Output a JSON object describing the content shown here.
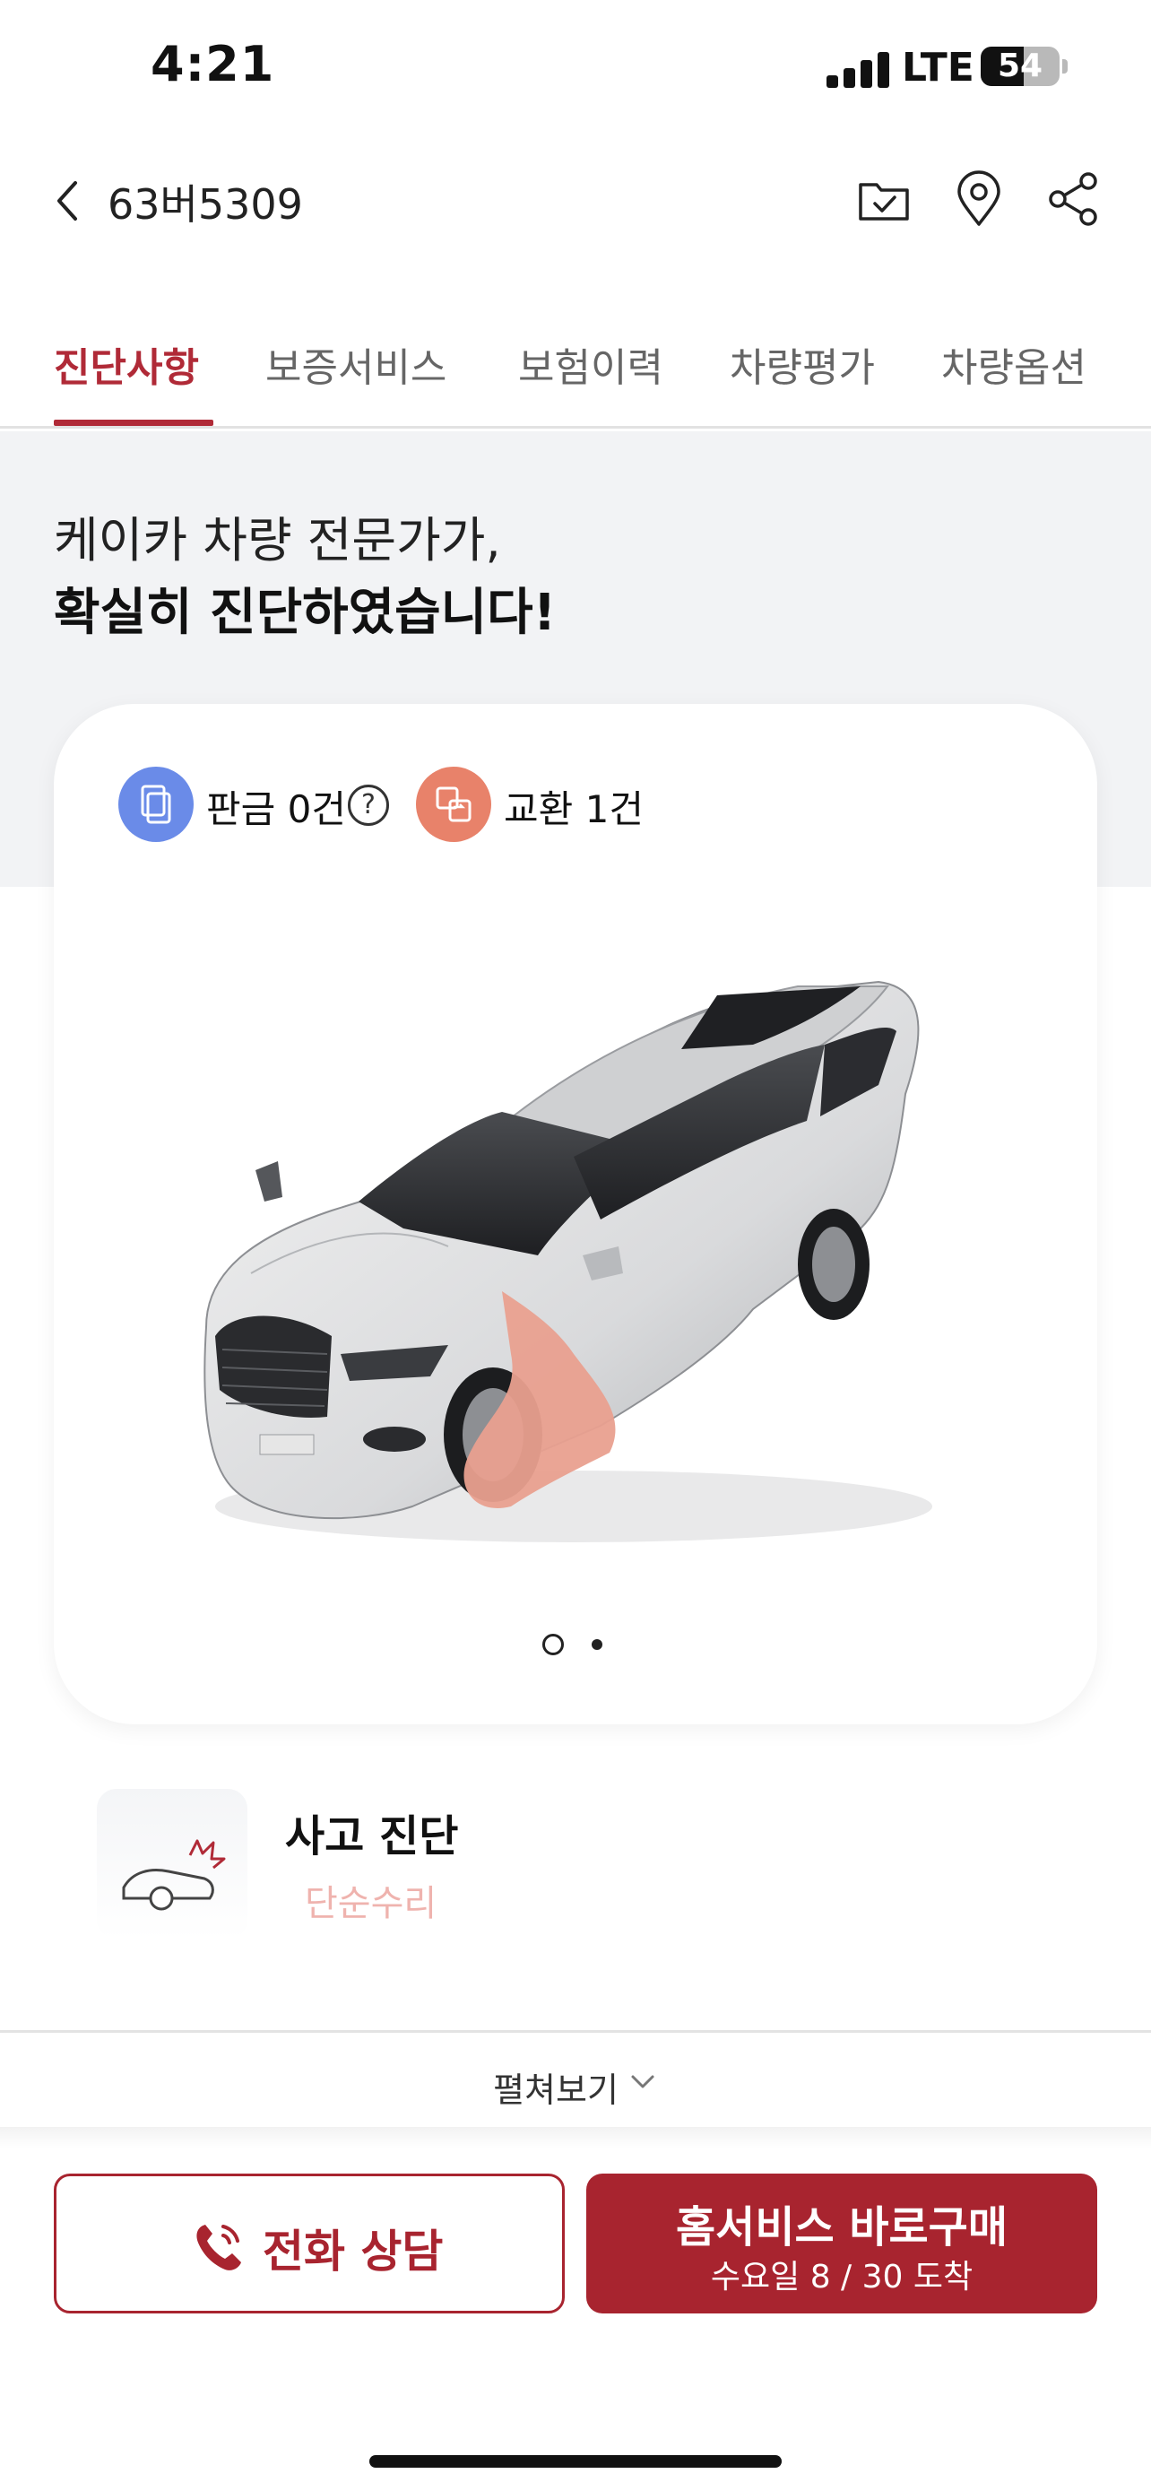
{
  "status_bar": {
    "time": "4:21",
    "network": "LTE",
    "battery": "54",
    "battery_level": 0.54
  },
  "header": {
    "title": "63버5309",
    "icons": [
      "chevron-left-icon",
      "folder-check-icon",
      "map-pin-icon",
      "share-icon"
    ]
  },
  "tabs": [
    {
      "label": "진단사항",
      "active": true
    },
    {
      "label": "보증서비스",
      "active": false
    },
    {
      "label": "보험이력",
      "active": false
    },
    {
      "label": "차량평가",
      "active": false
    },
    {
      "label": "차량옵션",
      "active": false
    }
  ],
  "intro": {
    "line1": "케이카 차량 전문가가,",
    "line2": "확실히 진단하였습니다!"
  },
  "card": {
    "legend": [
      {
        "label": "판금 0건",
        "color": "#6a8be8",
        "icon": "copy-icon"
      },
      {
        "label": "교환 1건",
        "color": "#e8826a",
        "icon": "swap-icon"
      }
    ],
    "help_symbol": "?",
    "carousel": {
      "current": 1,
      "total": 2
    },
    "highlight_color": "#e9a08f"
  },
  "diagnosis": {
    "title": "사고 진단",
    "result": "단순수리"
  },
  "expand": {
    "label": "펼쳐보기"
  },
  "bottom": {
    "call_label": "전화 상담",
    "buy_label": "홈서비스 바로구매",
    "buy_sub": "수요일 8 / 30 도착",
    "accent": "#a8242f"
  }
}
